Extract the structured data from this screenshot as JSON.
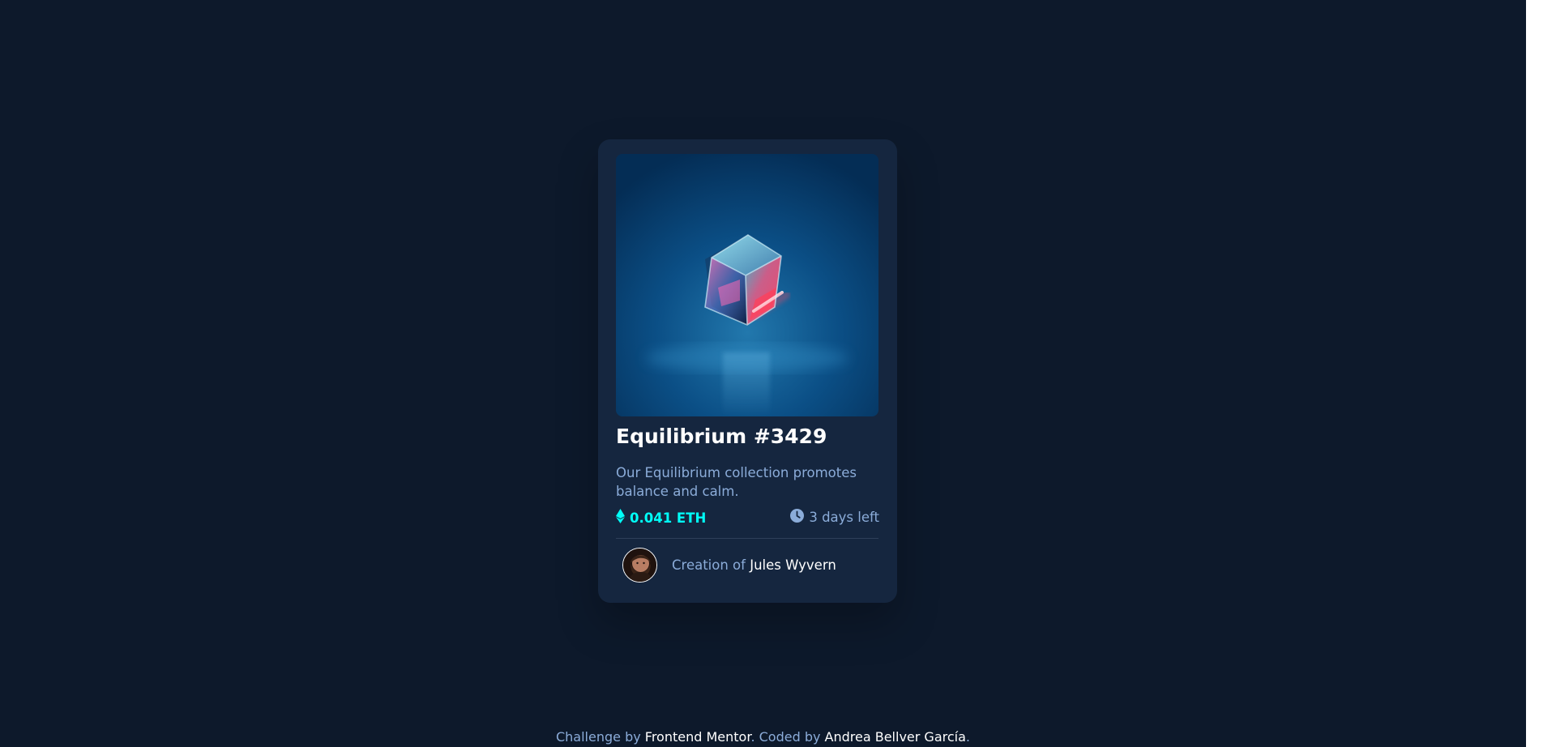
{
  "card": {
    "image_alt": "Equilibrium crystal cube",
    "title": "Equilibrium #3429",
    "description": "Our Equilibrium collection promotes balance and calm.",
    "price": "0.041 ETH",
    "time_left": "3 days left",
    "creator_prefix": "Creation of ",
    "creator_name": "Jules Wyvern"
  },
  "attribution": {
    "prefix": "Challenge by ",
    "challenge_link": "Frontend Mentor",
    "middle": ". Coded by ",
    "author_link": "Andrea Bellver García",
    "suffix": "."
  },
  "icons": {
    "price": "ethereum-icon",
    "time": "clock-icon"
  },
  "colors": {
    "page_background": "#0d192b",
    "card_background": "#15263f",
    "accent_cyan": "#00fff8",
    "soft_blue": "#8bacd9",
    "white": "#ffffff",
    "divider": "#2e405a"
  }
}
